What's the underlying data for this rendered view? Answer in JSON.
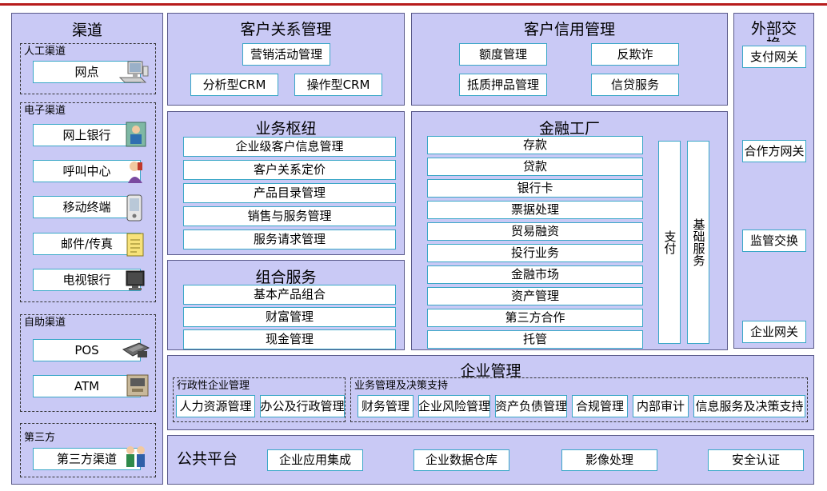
{
  "channels": {
    "title": "渠道",
    "manual": {
      "label": "人工渠道",
      "items": [
        "网点"
      ]
    },
    "electronic": {
      "label": "电子渠道",
      "items": [
        "网上银行",
        "呼叫中心",
        "移动终端",
        "邮件/传真",
        "电视银行"
      ]
    },
    "self_service": {
      "label": "自助渠道",
      "items": [
        "POS",
        "ATM"
      ]
    },
    "third_party": {
      "label": "第三方",
      "items": [
        "第三方渠道"
      ]
    }
  },
  "crm": {
    "title": "客户关系管理",
    "items": [
      "营销活动管理",
      "分析型CRM",
      "操作型CRM"
    ]
  },
  "credit": {
    "title": "客户信用管理",
    "items": [
      "额度管理",
      "反欺诈",
      "抵质押品管理",
      "信贷服务"
    ]
  },
  "external": {
    "title": "外部交换",
    "items": [
      "支付网关",
      "合作方网关",
      "监管交换",
      "企业网关"
    ]
  },
  "hub": {
    "title": "业务枢纽",
    "items": [
      "企业级客户信息管理",
      "客户关系定价",
      "产品目录管理",
      "销售与服务管理",
      "服务请求管理"
    ]
  },
  "combo": {
    "title": "组合服务",
    "items": [
      "基本产品组合",
      "财富管理",
      "现金管理"
    ]
  },
  "factory": {
    "title": "金融工厂",
    "items": [
      "存款",
      "贷款",
      "银行卡",
      "票据处理",
      "贸易融资",
      "投行业务",
      "金融市场",
      "资产管理",
      "第三方合作",
      "托管"
    ],
    "pay": "支付",
    "base": "基础服务"
  },
  "enterprise": {
    "title": "企业管理",
    "admin": {
      "label": "行政性企业管理",
      "items": [
        "人力资源管理",
        "办公及行政管理"
      ]
    },
    "decision": {
      "label": "业务管理及决策支持",
      "items": [
        "财务管理",
        "企业风险管理",
        "资产负债管理",
        "合规管理",
        "内部审计",
        "信息服务及决策支持"
      ]
    }
  },
  "platform": {
    "title": "公共平台",
    "items": [
      "企业应用集成",
      "企业数据仓库",
      "影像处理",
      "安全认证"
    ]
  }
}
